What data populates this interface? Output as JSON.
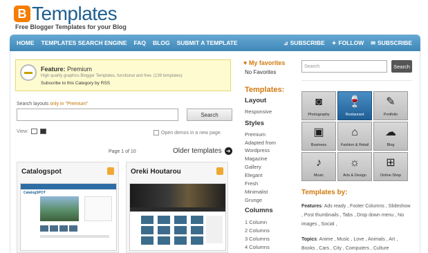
{
  "header": {
    "logo_letter": "B",
    "logo_text": "Templates",
    "tagline": "Free Blogger Templates for your Blog"
  },
  "nav": {
    "items": [
      "HOME",
      "TEMPLATES SEARCH ENGINE",
      "FAQ",
      "BLOG",
      "SUBMIT A TEMPLATE"
    ],
    "subscribe_rss": "SUBSCRIBE",
    "follow": "FOLLOW",
    "subscribe_email": "SUBSCRIBE"
  },
  "feature": {
    "label": "Feature:",
    "value": "Premium",
    "description": "High quality graphics Blogger Templates, functional and free. (139 templates)",
    "rss": "Subscribe to this Category by RSS"
  },
  "search": {
    "label_prefix": "Search layouts",
    "label_only": "only in",
    "label_quote": "\"Premium\"",
    "button": "Search"
  },
  "view": {
    "label": "View:",
    "open_demos": "Open demos in a new page."
  },
  "pagination": {
    "page_info": "Page 1 of 10",
    "older": "Older templates"
  },
  "cards": [
    {
      "title": "Catalogspot",
      "screenshot_logo": "CatalogSPOT"
    },
    {
      "title": "Oreki Houtarou"
    }
  ],
  "favorites": {
    "title": "My favorites",
    "empty": "No Favorites"
  },
  "templates_menu": {
    "title": "Templates:",
    "layout_heading": "Layout",
    "layout_items": [
      "Responsive"
    ],
    "styles_heading": "Styles",
    "styles_items": [
      "Premium",
      "Adapted from",
      "Wordpress",
      "Magazine",
      "Gallery",
      "Elegant",
      "Fresh",
      "Minimalist",
      "Grunge"
    ],
    "columns_heading": "Columns",
    "columns_items": [
      "1 Column",
      "2 Columns",
      "3 Columns",
      "4 Columns"
    ]
  },
  "right_search": {
    "placeholder": "Search",
    "button": "Search"
  },
  "categories": [
    {
      "label": "Photography",
      "icon": "camera-icon"
    },
    {
      "label": "Restaurant",
      "icon": "wine-glasses-icon",
      "active": true
    },
    {
      "label": "Portfolio",
      "icon": "portfolio-icon"
    },
    {
      "label": "Business",
      "icon": "briefcase-icon"
    },
    {
      "label": "Fashion & Retail",
      "icon": "price-tag-icon"
    },
    {
      "label": "Blog",
      "icon": "chat-icon"
    },
    {
      "label": "Music",
      "icon": "microphone-icon"
    },
    {
      "label": "Arts & Design",
      "icon": "lightbulb-icon"
    },
    {
      "label": "Online Shop",
      "icon": "shopping-basket-icon"
    }
  ],
  "templates_by": {
    "title": "Templates by:",
    "features_label": "Features",
    "features_text": ": Ads ready , Footer Columns , Slideshow , Post thumbnails , Tabs , Drop down menu , No images , Social ,",
    "topics_label": "Topics",
    "topics_text": ": Anime , Music , Love , Animals , Art , Books , Cars , City , Computers , Culture"
  },
  "colors": {
    "nav": "#3f87b8",
    "accent_orange": "#d07a10",
    "brand_blue": "#1e5f8f",
    "feature_bg": "#fefbd0"
  }
}
